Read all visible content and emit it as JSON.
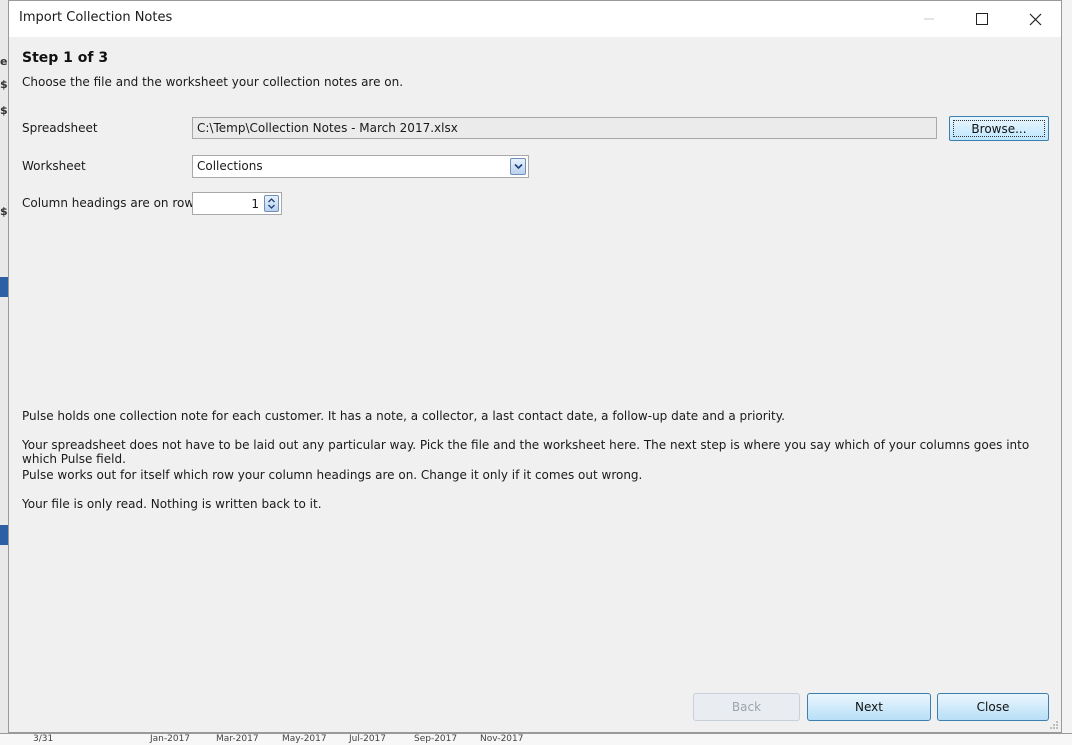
{
  "window": {
    "title": "Import Collection Notes"
  },
  "step": {
    "title": "Step 1 of 3",
    "subtitle": "Choose the file and the worksheet your collection notes are on."
  },
  "form": {
    "spreadsheet_label": "Spreadsheet",
    "spreadsheet_value": "C:\\Temp\\Collection Notes - March 2017.xlsx",
    "browse_label": "Browse...",
    "worksheet_label": "Worksheet",
    "worksheet_value": "Collections",
    "headings_label": "Column headings are on row",
    "headings_row": "1"
  },
  "info": [
    "Pulse holds one collection note for each customer.  It has a note, a collector, a last contact date, a follow-up date and a priority.",
    "Your spreadsheet does not have to be laid out any particular way.  Pick the file and the worksheet here.  The next step is where you say which of your columns goes into which Pulse field.",
    "Pulse works out for itself which row your column headings are on.  Change it only if it comes out wrong.",
    "Your file is only read.  Nothing is written back to it."
  ],
  "buttons": {
    "back": "Back",
    "next": "Next",
    "close": "Close"
  },
  "background": {
    "left_glyphs": [
      "er",
      "$",
      "$",
      "$"
    ],
    "bottom_labels": [
      "3/31",
      "Jan-2017",
      "Mar-2017",
      "May-2017",
      "Jul-2017",
      "Sep-2017",
      "Nov-2017"
    ]
  },
  "colors": {
    "accent_border": "#3c7fb1",
    "button_gradient_top": "#eaf6fd",
    "button_gradient_bottom": "#b8dff8",
    "dialog_bg": "#f0f0f0"
  },
  "icons": {
    "minimize": "minimize-icon",
    "maximize": "maximize-icon",
    "close": "close-icon",
    "dropdown": "chevron-down-icon",
    "spinner": "spin-arrows-icon",
    "grip": "resize-grip-icon"
  }
}
